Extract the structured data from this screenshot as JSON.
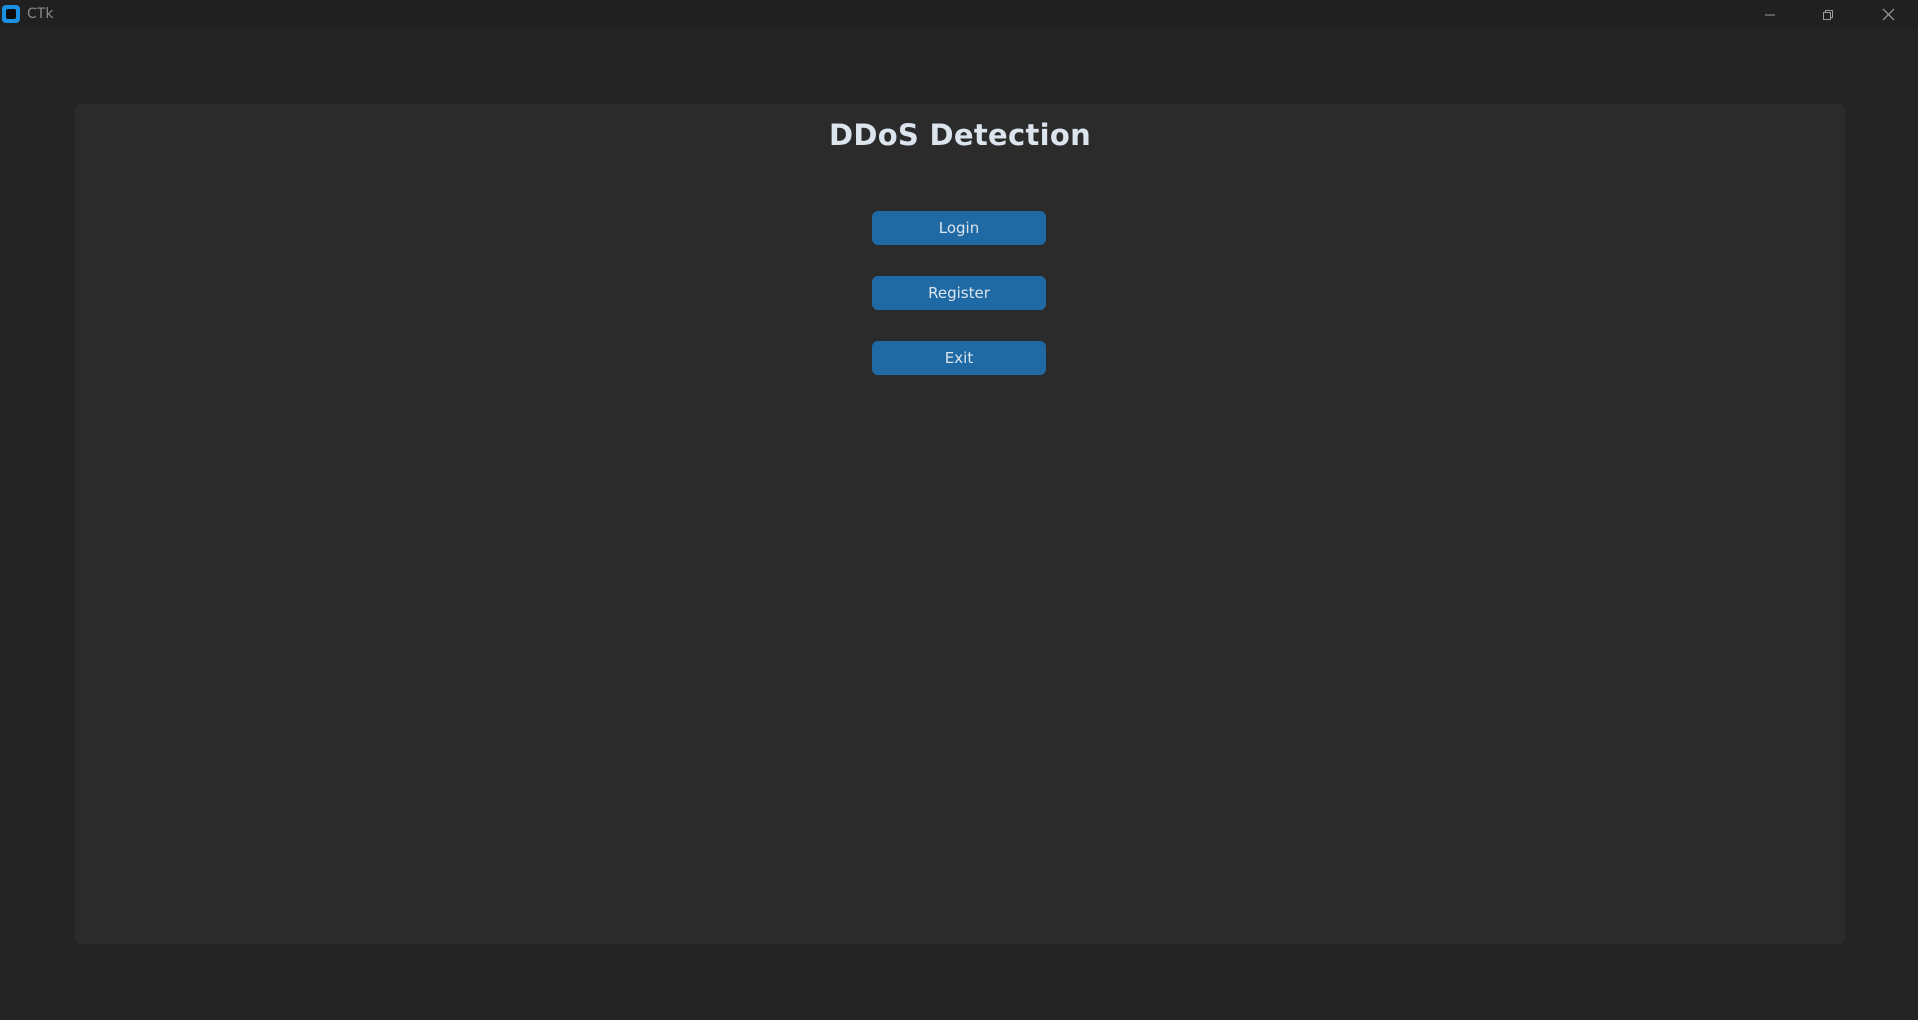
{
  "window": {
    "title": "CTk",
    "app_icon": "ctk-app-icon",
    "controls": {
      "minimize_icon": "minimize-icon",
      "maximize_icon": "restore-icon",
      "close_icon": "close-icon"
    }
  },
  "main": {
    "title": "DDoS Detection",
    "buttons": {
      "login": "Login",
      "register": "Register",
      "exit": "Exit"
    }
  },
  "colors": {
    "background": "#242424",
    "panel": "#2b2b2b",
    "titlebar": "#202020",
    "button": "#1f6aa5",
    "button_text": "#dce4ee",
    "title_text": "#dce4ee",
    "app_icon": "#1b8fe0"
  }
}
